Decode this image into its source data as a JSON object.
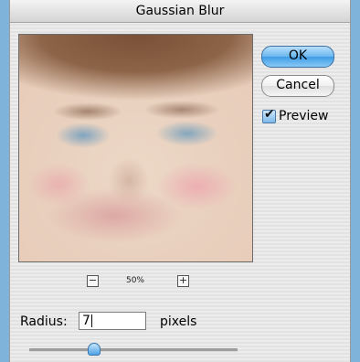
{
  "dialog": {
    "title": "Gaussian Blur"
  },
  "preview": {
    "zoom_label": "50%",
    "zoom_out_symbol": "−",
    "zoom_in_symbol": "+"
  },
  "buttons": {
    "ok_label": "OK",
    "cancel_label": "Cancel"
  },
  "preview_toggle": {
    "label": "Preview",
    "checked": true,
    "checkmark": "✔"
  },
  "radius": {
    "label": "Radius:",
    "value": "7",
    "unit_label": "pixels"
  },
  "slider": {
    "level": 0.31
  },
  "colors": {
    "background": "#7fb3d9",
    "accent": "#3f9ce6"
  }
}
